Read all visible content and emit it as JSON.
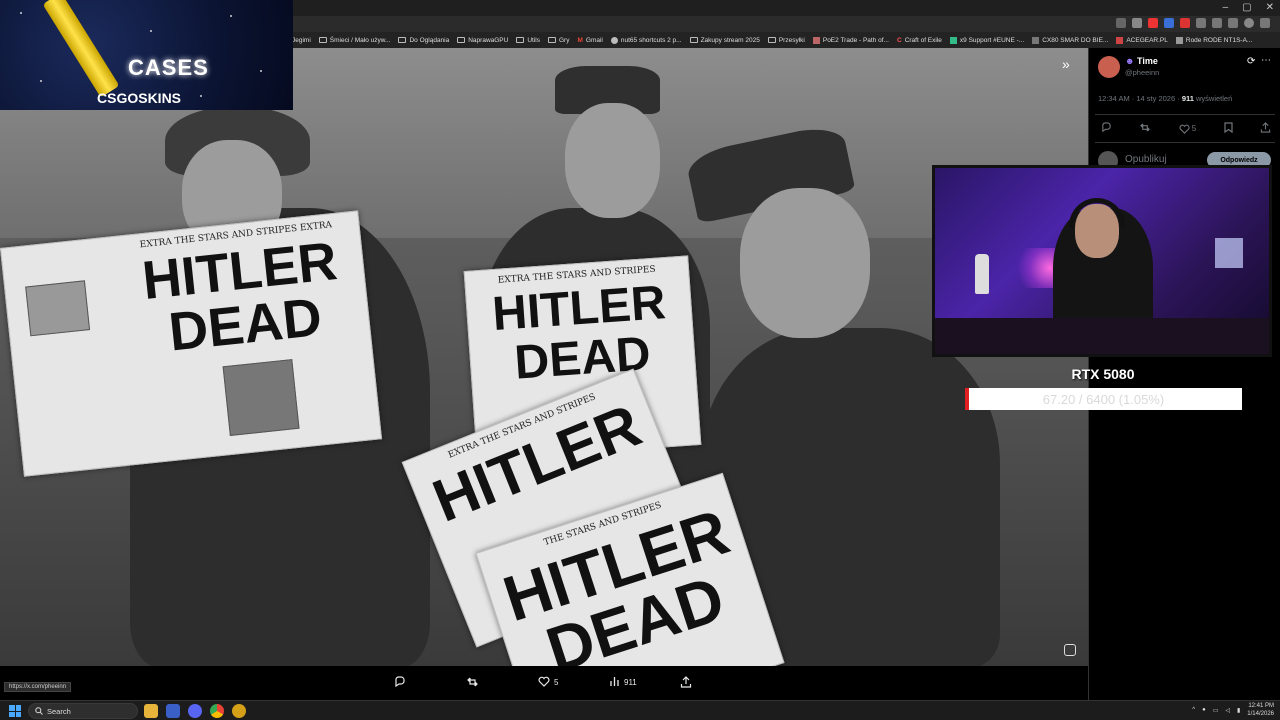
{
  "browser": {
    "bookmarks": [
      "Śmieci / Mało używ...",
      "Do Oglądania",
      "NaprawaGPU",
      "Utils",
      "Gry",
      "Gmail",
      "nut65 shortcuts 2 p...",
      "Zakupy stream 2025",
      "Przesyłki",
      "PoE2 Trade - Path of...",
      "Craft of Exile",
      "x9 Support #EUNE -...",
      "CX80 SMAR DO BIE...",
      "ACEGEAR.PL",
      "Rode RODE NT1S-A..."
    ],
    "partial_bookmark": "Jegimi",
    "status_url": "https://x.com/pheeinn"
  },
  "overlay": {
    "cases_text": "CASES",
    "skins_text": "CSGOSKINS"
  },
  "photo": {
    "newspaper_masthead": "THE STARS AND STRIPES",
    "newspaper_extra": "EXTRA",
    "headline_1": "HITLER",
    "headline_2": "DEAD"
  },
  "viewer_actions": {
    "reply_count": "",
    "likes": "5",
    "views": "911"
  },
  "post": {
    "display_name": "Time",
    "handle": "@pheeinn",
    "time": "12:34 AM · 14 sty 2026 ·",
    "views_count": "911",
    "views_label": "wyświetleń",
    "likes": "5",
    "compose_placeholder": "Opublikuj",
    "reply_button": "Odpowiedz"
  },
  "gpu": {
    "name": "RTX 5080",
    "usage_text": "67.20 / 6400 (1.05%)",
    "usage_fraction": 0.0105
  },
  "taskbar": {
    "search_label": "Search",
    "time": "12:41 PM",
    "date": "1/14/2026"
  },
  "colors": {
    "accent_red": "#e02020",
    "panel_bg": "#000000",
    "taskbar_bg": "#1c1c1c"
  }
}
